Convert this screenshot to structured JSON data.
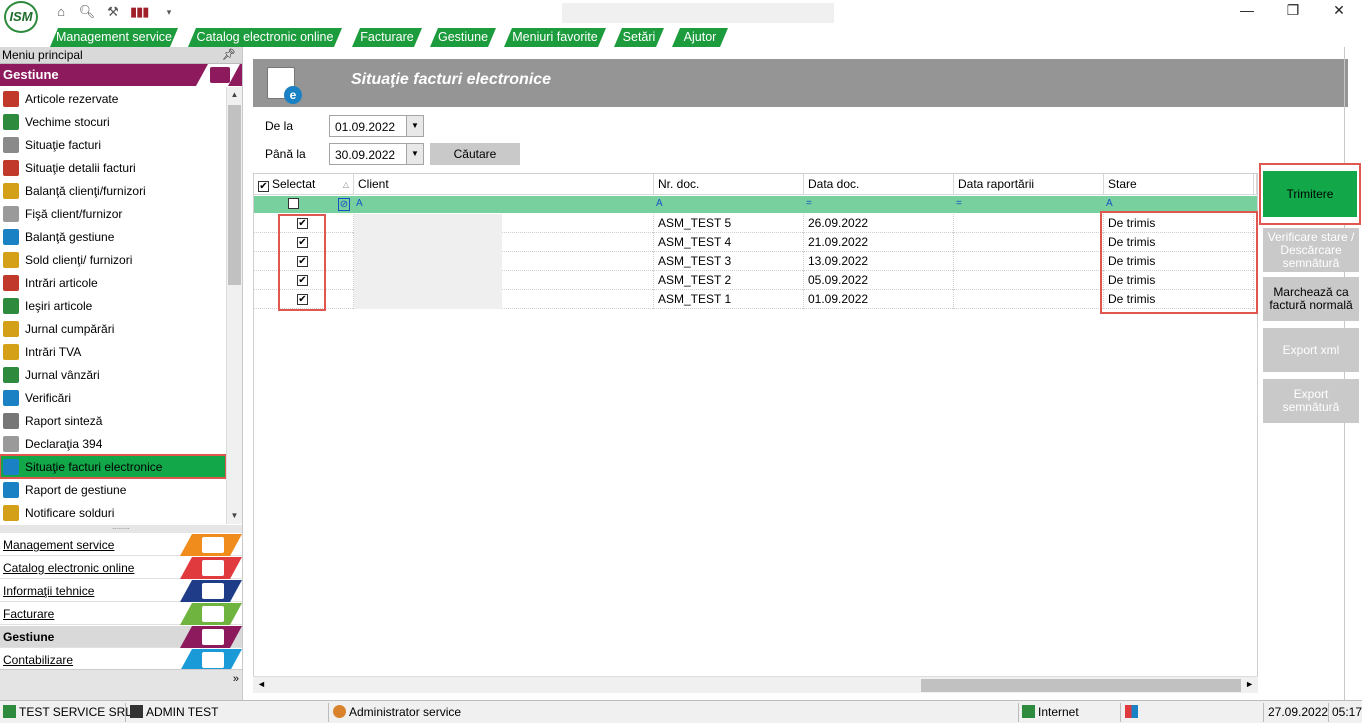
{
  "titlebar": {
    "logo_text": "ISM",
    "quick_icons": [
      "home-icon",
      "search-icon",
      "tools-icon",
      "barcode-icon",
      "dropdown-arrow-icon"
    ],
    "window_controls": {
      "minimize": "—",
      "restore": "❐",
      "close": "✕"
    }
  },
  "menu": {
    "items": [
      "Management service",
      "Catalog electronic online",
      "Facturare",
      "Gestiune",
      "Meniuri favorite",
      "Setări",
      "Ajutor"
    ]
  },
  "left_panel": {
    "header": "Meniu principal",
    "section": "Gestiune",
    "items": [
      {
        "label": "Articole rezervate",
        "color": "#c0392b"
      },
      {
        "label": "Vechime stocuri",
        "color": "#2e8b3e"
      },
      {
        "label": "Situaţie facturi",
        "color": "#8a8a8a"
      },
      {
        "label": "Situaţie detalii facturi",
        "color": "#c0392b"
      },
      {
        "label": "Balanţă clienţi/furnizori",
        "color": "#d4a017"
      },
      {
        "label": "Fişă client/furnizor",
        "color": "#9a9a9a"
      },
      {
        "label": "Balanţă gestiune",
        "color": "#1a82c4"
      },
      {
        "label": "Sold clienţi/ furnizori",
        "color": "#d4a017"
      },
      {
        "label": "Intrări articole",
        "color": "#c0392b"
      },
      {
        "label": "Ieşiri articole",
        "color": "#2e8b3e"
      },
      {
        "label": "Jurnal cumpărări",
        "color": "#d4a017"
      },
      {
        "label": "Intrări TVA",
        "color": "#d4a017"
      },
      {
        "label": "Jurnal vânzări",
        "color": "#2e8b3e"
      },
      {
        "label": "Verificări",
        "color": "#1a82c4"
      },
      {
        "label": "Raport sinteză",
        "color": "#777777"
      },
      {
        "label": "Declaraţia 394",
        "color": "#9a9a9a"
      },
      {
        "label": "Situaţie facturi electronice",
        "color": "#1a82c4"
      },
      {
        "label": "Raport de gestiune",
        "color": "#1a82c4"
      },
      {
        "label": "Notificare solduri",
        "color": "#d4a017"
      }
    ],
    "active_index": 16,
    "modules": [
      {
        "label": "Management service",
        "color": "#ef8c1b"
      },
      {
        "label": "Catalog electronic online",
        "color": "#e03a3e"
      },
      {
        "label": "Informaţii tehnice",
        "color": "#1f3c88"
      },
      {
        "label": "Facturare",
        "color": "#6fb43f"
      },
      {
        "label": "Gestiune",
        "color": "#8c1a5c"
      },
      {
        "label": "Contabilizare",
        "color": "#1a9bd7"
      }
    ],
    "current_module": "Gestiune",
    "expand_glyph": "»"
  },
  "main": {
    "title": "Situaţie facturi electronice",
    "filters": {
      "from_label": "De la",
      "from_value": "01.09.2022",
      "to_label": "Până la",
      "to_value": "30.09.2022",
      "search_button": "Căutare"
    },
    "grid": {
      "columns": [
        "Selectat",
        "Client",
        "Nr. doc.",
        "Data doc.",
        "Data raportării",
        "Stare",
        ""
      ],
      "rows": [
        {
          "checked": true,
          "client": "",
          "nr_doc": "ASM_TEST 5",
          "data_doc": "26.09.2022",
          "data_raportarii": "",
          "stare": "De trimis"
        },
        {
          "checked": true,
          "client": "",
          "nr_doc": "ASM_TEST 4",
          "data_doc": "21.09.2022",
          "data_raportarii": "",
          "stare": "De trimis"
        },
        {
          "checked": true,
          "client": "",
          "nr_doc": "ASM_TEST 3",
          "data_doc": "13.09.2022",
          "data_raportarii": "",
          "stare": "De trimis"
        },
        {
          "checked": true,
          "client": "",
          "nr_doc": "ASM_TEST 2",
          "data_doc": "05.09.2022",
          "data_raportarii": "",
          "stare": "De trimis"
        },
        {
          "checked": true,
          "client": "",
          "nr_doc": "ASM_TEST 1",
          "data_doc": "01.09.2022",
          "data_raportarii": "",
          "stare": "De trimis"
        }
      ]
    },
    "actions": {
      "send": "Trimitere",
      "verify": "Verificare stare / Descărcare semnătură",
      "mark_normal": "Marchează ca factură normală",
      "export_xml": "Export xml",
      "export_signature": "Export semnătură"
    }
  },
  "statusbar": {
    "company": "TEST SERVICE SRL",
    "user": "ADMIN TEST",
    "role": "Administrator service",
    "zone": "Internet",
    "date": "27.09.2022",
    "time": "05:17"
  },
  "colors": {
    "accent_green": "#1c9c3c",
    "gestiune": "#8c1a5c",
    "highlight_red": "#e0574f"
  }
}
